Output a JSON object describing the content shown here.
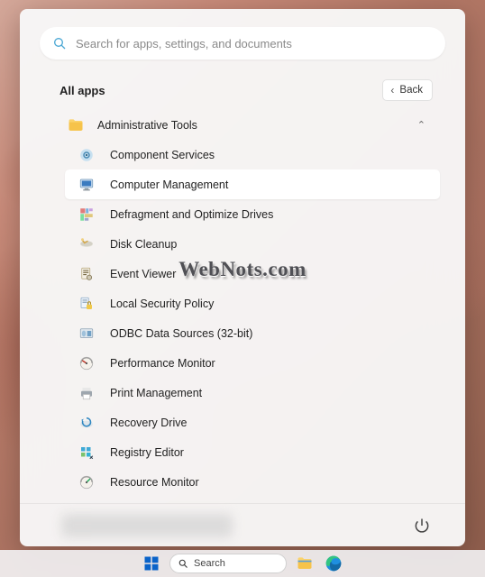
{
  "search": {
    "placeholder": "Search for apps, settings, and documents"
  },
  "header": {
    "title": "All apps",
    "back": "Back"
  },
  "folder": {
    "label": "Administrative Tools"
  },
  "items": [
    {
      "label": "Component Services"
    },
    {
      "label": "Computer Management"
    },
    {
      "label": "Defragment and Optimize Drives"
    },
    {
      "label": "Disk Cleanup"
    },
    {
      "label": "Event Viewer"
    },
    {
      "label": "Local Security Policy"
    },
    {
      "label": "ODBC Data Sources (32-bit)"
    },
    {
      "label": "Performance Monitor"
    },
    {
      "label": "Print Management"
    },
    {
      "label": "Recovery Drive"
    },
    {
      "label": "Registry Editor"
    },
    {
      "label": "Resource Monitor"
    }
  ],
  "taskbar": {
    "search": "Search"
  },
  "watermark": "WebNots.com"
}
